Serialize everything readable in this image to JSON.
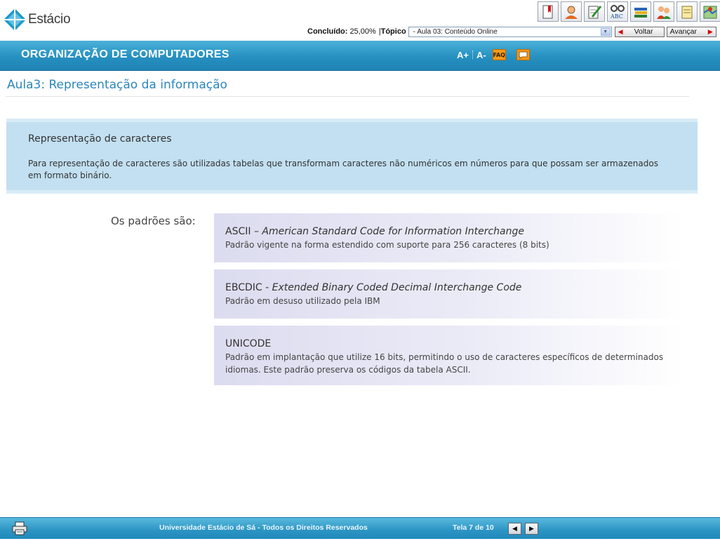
{
  "brand": {
    "name": "Estácio"
  },
  "toolbar": {
    "icons": [
      "bookmark-icon",
      "tutor-icon",
      "notes-icon",
      "glossary-icon",
      "library-icon",
      "forum-icon",
      "documents-icon",
      "map-icon"
    ]
  },
  "progress": {
    "label": "Concluído:",
    "value": "25,00%",
    "divider": "|"
  },
  "topic": {
    "label": "Tópico",
    "selected": "- Aula 03: Conteúdo Online"
  },
  "navigation": {
    "back_label": "Voltar",
    "forward_label": "Avançar"
  },
  "course": {
    "title": "ORGANIZAÇÃO DE COMPUTADORES",
    "font_increase": "A+",
    "font_decrease": "A-",
    "faq": "FAQ"
  },
  "page": {
    "title": "Aula3: Representação da informação"
  },
  "intro": {
    "heading": "Representação de caracteres",
    "text": "Para representação de caracteres são utilizadas tabelas que transformam caracteres não numéricos em números para que possam ser armazenados em formato binário."
  },
  "standards": {
    "label": "Os padrões são:",
    "items": [
      {
        "acronym": "ASCII",
        "separator": " – ",
        "full_name": "American Standard Code for Information Interchange",
        "description": "Padrão vigente na forma estendido com suporte para 256 caracteres (8 bits)"
      },
      {
        "acronym": "EBCDIC",
        "separator": " - ",
        "full_name": "Extended Binary Coded Decimal Interchange Code",
        "description": "Padrão em desuso utilizado pela IBM"
      },
      {
        "acronym": "UNICODE",
        "separator": "",
        "full_name": "",
        "description": "Padrão em implantação que utilize 16 bits, permitindo o uso de caracteres específicos de determinados idiomas. Este padrão preserva os códigos da tabela ASCII."
      }
    ]
  },
  "footer": {
    "copyright": "Universidade Estácio de Sá - Todos os Direitos Reservados",
    "screen_counter": "Tela 7 de 10"
  },
  "colors": {
    "accent": "#2690c0",
    "title": "#2b86bd",
    "intro_bg": "#c2e0f1",
    "card_bg": "#dcdcf0"
  }
}
